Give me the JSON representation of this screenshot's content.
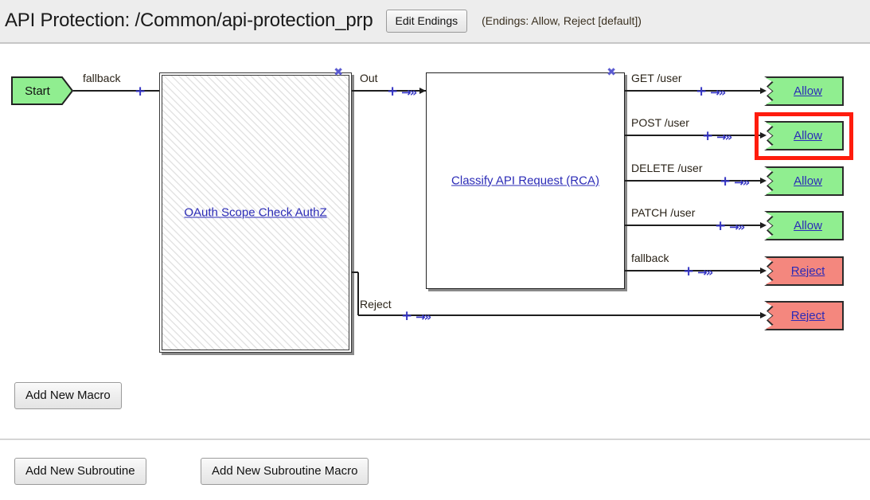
{
  "header": {
    "title": "API Protection: /Common/api-protection_prp",
    "edit_endings_label": "Edit Endings",
    "endings_note": "(Endings: Allow, Reject [default])",
    "background_color": "#ededed"
  },
  "canvas": {
    "start_node": {
      "label": "Start",
      "fill_color": "#90ee90"
    },
    "macro": {
      "label": "OAuth Scope Check AuthZ",
      "close_icon": "close-icon",
      "link_color": "#2b2bb7",
      "branches": [
        {
          "label": "Out"
        },
        {
          "label": "Reject"
        }
      ]
    },
    "rule": {
      "label": "Classify API Request (RCA)",
      "close_icon": "close-icon",
      "link_color": "#2b2bb7"
    },
    "start_branch_label": "fallback",
    "rule_branches": [
      {
        "label": "GET /user",
        "ending": "Allow",
        "type": "allow",
        "highlighted": false
      },
      {
        "label": "POST /user",
        "ending": "Allow",
        "type": "allow",
        "highlighted": true
      },
      {
        "label": "DELETE /user",
        "ending": "Allow",
        "type": "allow",
        "highlighted": false
      },
      {
        "label": "PATCH /user",
        "ending": "Allow",
        "type": "allow",
        "highlighted": false
      },
      {
        "label": "fallback",
        "ending": "Reject",
        "type": "reject",
        "highlighted": false
      }
    ],
    "macro_reject_ending": {
      "ending": "Reject",
      "type": "reject"
    },
    "glyphs": {
      "add": "+",
      "arrow": "→»"
    },
    "colors": {
      "allow_fill": "#90ee90",
      "reject_fill": "#f4877e",
      "highlight": "#ff1c0d",
      "connector": "#3434c4",
      "wire": "#1e1e1e"
    }
  },
  "footer": {
    "add_new_macro_label": "Add New Macro",
    "add_new_subroutine_label": "Add New Subroutine",
    "add_new_subroutine_macro_label": "Add New Subroutine Macro"
  }
}
